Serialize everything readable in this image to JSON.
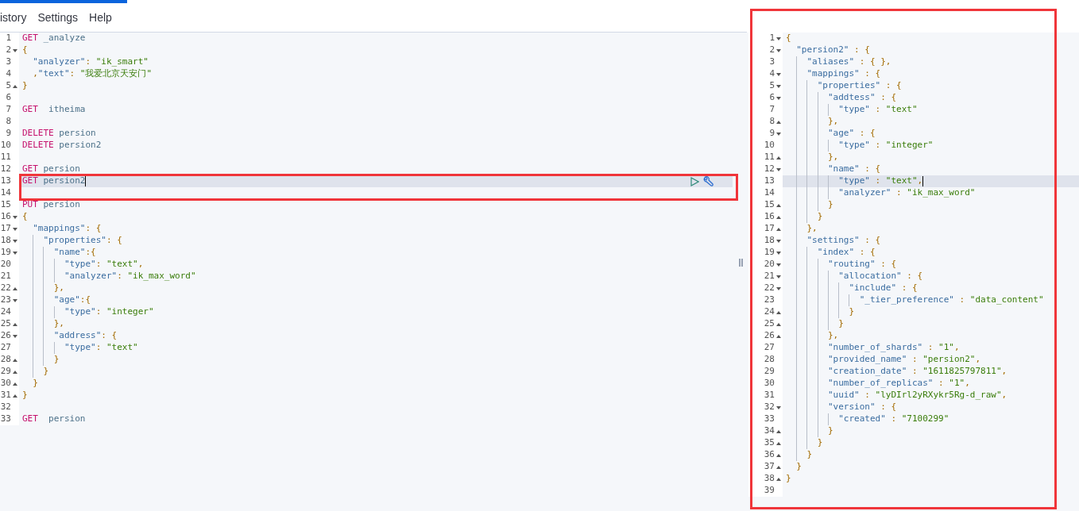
{
  "menu": [
    "istory",
    "Settings",
    "Help"
  ],
  "request_editor": {
    "lines": [
      {
        "n": "1",
        "selected": false,
        "tokens": [
          {
            "kind": "method",
            "t": "GET"
          },
          {
            "kind": "path",
            "t": " _analyze"
          }
        ]
      },
      {
        "n": "2",
        "selected": false,
        "expanded": true,
        "tokens": [
          {
            "kind": "punct",
            "t": "{"
          }
        ]
      },
      {
        "n": "3",
        "selected": false,
        "tokens": [
          {
            "kind": "key",
            "t": "\"analyzer\""
          },
          {
            "kind": "punct",
            "t": ": "
          },
          {
            "kind": "string",
            "t": "\"ik_smart\""
          }
        ]
      },
      {
        "n": "4",
        "selected": false,
        "tokens": [
          {
            "kind": "punct",
            "t": ","
          },
          {
            "kind": "key",
            "t": "\"text\""
          },
          {
            "kind": "punct",
            "t": ": "
          },
          {
            "kind": "string",
            "t": "\"我爱北京天安门\""
          }
        ]
      },
      {
        "n": "5",
        "selected": false,
        "fold_end": true,
        "tokens": [
          {
            "kind": "punct",
            "t": "}"
          }
        ]
      },
      {
        "n": "6",
        "selected": false
      },
      {
        "n": "7",
        "selected": false,
        "tokens": [
          {
            "kind": "method",
            "t": "GET"
          },
          {
            "kind": "path",
            "t": "  itheima"
          }
        ]
      },
      {
        "n": "8",
        "selected": false
      },
      {
        "n": "9",
        "selected": false,
        "tokens": [
          {
            "kind": "method",
            "t": "DELETE"
          },
          {
            "kind": "path",
            "t": " persion"
          }
        ]
      },
      {
        "n": "10",
        "selected": false,
        "tokens": [
          {
            "kind": "method",
            "t": "DELETE"
          },
          {
            "kind": "path",
            "t": " persion2"
          }
        ]
      },
      {
        "n": "11",
        "selected": false
      },
      {
        "n": "12",
        "selected": false,
        "tokens": [
          {
            "kind": "method",
            "t": "GET"
          },
          {
            "kind": "path",
            "t": " persion"
          }
        ]
      },
      {
        "n": "13",
        "selected": true,
        "tokens": [
          {
            "kind": "method",
            "t": "GET"
          },
          {
            "kind": "path",
            "t": " persion2"
          }
        ]
      },
      {
        "n": "14",
        "selected": false
      },
      {
        "n": "15",
        "selected": false,
        "tokens": [
          {
            "kind": "method",
            "t": "PUT"
          },
          {
            "kind": "path",
            "t": " persion"
          }
        ]
      },
      {
        "n": "16",
        "selected": false,
        "expanded": true,
        "tokens": [
          {
            "kind": "punct",
            "t": "{"
          }
        ]
      },
      {
        "n": "17",
        "selected": false,
        "expanded": true,
        "tokens": [
          {
            "kind": "key",
            "t": "\"mappings\""
          },
          {
            "kind": "punct",
            "t": ": {"
          }
        ]
      },
      {
        "n": "18",
        "selected": false,
        "expanded": true,
        "tokens": [
          {
            "kind": "key",
            "t": "\"properties\""
          },
          {
            "kind": "punct",
            "t": ": {"
          }
        ]
      },
      {
        "n": "19",
        "selected": false,
        "expanded": true,
        "tokens": [
          {
            "kind": "key",
            "t": "\"name\""
          },
          {
            "kind": "punct",
            "t": ":{"
          }
        ]
      },
      {
        "n": "20",
        "selected": false,
        "tokens": [
          {
            "kind": "key",
            "t": "\"type\""
          },
          {
            "kind": "punct",
            "t": ": "
          },
          {
            "kind": "string",
            "t": "\"text\""
          },
          {
            "kind": "punct",
            "t": ","
          }
        ]
      },
      {
        "n": "21",
        "selected": false,
        "tokens": [
          {
            "kind": "key",
            "t": "\"analyzer\""
          },
          {
            "kind": "punct",
            "t": ": "
          },
          {
            "kind": "string",
            "t": "\"ik_max_word\""
          }
        ]
      },
      {
        "n": "22",
        "selected": false,
        "fold_end": true,
        "tokens": [
          {
            "kind": "punct",
            "t": "},"
          }
        ]
      },
      {
        "n": "23",
        "selected": false,
        "expanded": true,
        "tokens": [
          {
            "kind": "key",
            "t": "\"age\""
          },
          {
            "kind": "punct",
            "t": ":{"
          }
        ]
      },
      {
        "n": "24",
        "selected": false,
        "tokens": [
          {
            "kind": "key",
            "t": "\"type\""
          },
          {
            "kind": "punct",
            "t": ": "
          },
          {
            "kind": "string",
            "t": "\"integer\""
          }
        ]
      },
      {
        "n": "25",
        "selected": false,
        "fold_end": true,
        "tokens": [
          {
            "kind": "punct",
            "t": "},"
          }
        ]
      },
      {
        "n": "26",
        "selected": false,
        "expanded": true,
        "tokens": [
          {
            "kind": "key",
            "t": "\"address\""
          },
          {
            "kind": "punct",
            "t": ": {"
          }
        ]
      },
      {
        "n": "27",
        "selected": false,
        "tokens": [
          {
            "kind": "key",
            "t": "\"type\""
          },
          {
            "kind": "punct",
            "t": ": "
          },
          {
            "kind": "string",
            "t": "\"text\""
          }
        ]
      },
      {
        "n": "28",
        "selected": false,
        "fold_end": true,
        "tokens": [
          {
            "kind": "punct",
            "t": "}"
          }
        ]
      },
      {
        "n": "29",
        "selected": false,
        "fold_end": true,
        "tokens": [
          {
            "kind": "punct",
            "t": "}"
          }
        ]
      },
      {
        "n": "30",
        "selected": false,
        "fold_end": true,
        "tokens": [
          {
            "kind": "punct",
            "t": "}"
          }
        ]
      },
      {
        "n": "31",
        "selected": false,
        "fold_end": true,
        "tokens": [
          {
            "kind": "punct",
            "t": "}"
          }
        ]
      },
      {
        "n": "32",
        "selected": false
      },
      {
        "n": "33",
        "selected": false,
        "tokens": [
          {
            "kind": "method",
            "t": "GET"
          },
          {
            "kind": "path",
            "t": "  persion"
          }
        ]
      }
    ]
  },
  "response_viewer": {
    "lines": [
      {
        "n": "1",
        "selected": false,
        "expanded": true,
        "tokens": [
          {
            "kind": "punct",
            "t": "{"
          }
        ]
      },
      {
        "n": "2",
        "selected": false,
        "expanded": true,
        "tokens": [
          {
            "kind": "key",
            "t": "\"persion2\""
          },
          {
            "kind": "punct",
            "t": " : {"
          }
        ]
      },
      {
        "n": "3",
        "selected": false,
        "tokens": [
          {
            "kind": "key",
            "t": "\"aliases\""
          },
          {
            "kind": "punct",
            "t": " : { },"
          }
        ]
      },
      {
        "n": "4",
        "selected": false,
        "expanded": true,
        "tokens": [
          {
            "kind": "key",
            "t": "\"mappings\""
          },
          {
            "kind": "punct",
            "t": " : {"
          }
        ]
      },
      {
        "n": "5",
        "selected": false,
        "expanded": true,
        "tokens": [
          {
            "kind": "key",
            "t": "\"properties\""
          },
          {
            "kind": "punct",
            "t": " : {"
          }
        ]
      },
      {
        "n": "6",
        "selected": false,
        "expanded": true,
        "tokens": [
          {
            "kind": "key",
            "t": "\"addtess\""
          },
          {
            "kind": "punct",
            "t": " : {"
          }
        ]
      },
      {
        "n": "7",
        "selected": false,
        "tokens": [
          {
            "kind": "key",
            "t": "\"type\""
          },
          {
            "kind": "punct",
            "t": " : "
          },
          {
            "kind": "string",
            "t": "\"text\""
          }
        ]
      },
      {
        "n": "8",
        "selected": false,
        "fold_end": true,
        "tokens": [
          {
            "kind": "punct",
            "t": "},"
          }
        ]
      },
      {
        "n": "9",
        "selected": false,
        "expanded": true,
        "tokens": [
          {
            "kind": "key",
            "t": "\"age\""
          },
          {
            "kind": "punct",
            "t": " : {"
          }
        ]
      },
      {
        "n": "10",
        "selected": false,
        "tokens": [
          {
            "kind": "key",
            "t": "\"type\""
          },
          {
            "kind": "punct",
            "t": " : "
          },
          {
            "kind": "string",
            "t": "\"integer\""
          }
        ]
      },
      {
        "n": "11",
        "selected": false,
        "fold_end": true,
        "tokens": [
          {
            "kind": "punct",
            "t": "},"
          }
        ]
      },
      {
        "n": "12",
        "selected": false,
        "expanded": true,
        "tokens": [
          {
            "kind": "key",
            "t": "\"name\""
          },
          {
            "kind": "punct",
            "t": " : {"
          }
        ]
      },
      {
        "n": "13",
        "selected": true,
        "tokens": [
          {
            "kind": "key",
            "t": "\"type\""
          },
          {
            "kind": "punct",
            "t": " : "
          },
          {
            "kind": "string",
            "t": "\"text\""
          },
          {
            "kind": "punct",
            "t": ","
          }
        ]
      },
      {
        "n": "14",
        "selected": false,
        "tokens": [
          {
            "kind": "key",
            "t": "\"analyzer\""
          },
          {
            "kind": "punct",
            "t": " : "
          },
          {
            "kind": "string",
            "t": "\"ik_max_word\""
          }
        ]
      },
      {
        "n": "15",
        "selected": false,
        "fold_end": true,
        "tokens": [
          {
            "kind": "punct",
            "t": "}"
          }
        ]
      },
      {
        "n": "16",
        "selected": false,
        "fold_end": true,
        "tokens": [
          {
            "kind": "punct",
            "t": "}"
          }
        ]
      },
      {
        "n": "17",
        "selected": false,
        "fold_end": true,
        "tokens": [
          {
            "kind": "punct",
            "t": "},"
          }
        ]
      },
      {
        "n": "18",
        "selected": false,
        "expanded": true,
        "tokens": [
          {
            "kind": "key",
            "t": "\"settings\""
          },
          {
            "kind": "punct",
            "t": " : {"
          }
        ]
      },
      {
        "n": "19",
        "selected": false,
        "expanded": true,
        "tokens": [
          {
            "kind": "key",
            "t": "\"index\""
          },
          {
            "kind": "punct",
            "t": " : {"
          }
        ]
      },
      {
        "n": "20",
        "selected": false,
        "expanded": true,
        "tokens": [
          {
            "kind": "key",
            "t": "\"routing\""
          },
          {
            "kind": "punct",
            "t": " : {"
          }
        ]
      },
      {
        "n": "21",
        "selected": false,
        "expanded": true,
        "tokens": [
          {
            "kind": "key",
            "t": "\"allocation\""
          },
          {
            "kind": "punct",
            "t": " : {"
          }
        ]
      },
      {
        "n": "22",
        "selected": false,
        "expanded": true,
        "tokens": [
          {
            "kind": "key",
            "t": "\"include\""
          },
          {
            "kind": "punct",
            "t": " : {"
          }
        ]
      },
      {
        "n": "23",
        "selected": false,
        "tokens": [
          {
            "kind": "key",
            "t": "\"_tier_preference\""
          },
          {
            "kind": "punct",
            "t": " : "
          },
          {
            "kind": "string",
            "t": "\"data_content\""
          }
        ]
      },
      {
        "n": "24",
        "selected": false,
        "fold_end": true,
        "tokens": [
          {
            "kind": "punct",
            "t": "}"
          }
        ]
      },
      {
        "n": "25",
        "selected": false,
        "fold_end": true,
        "tokens": [
          {
            "kind": "punct",
            "t": "}"
          }
        ]
      },
      {
        "n": "26",
        "selected": false,
        "fold_end": true,
        "tokens": [
          {
            "kind": "punct",
            "t": "},"
          }
        ]
      },
      {
        "n": "27",
        "selected": false,
        "tokens": [
          {
            "kind": "key",
            "t": "\"number_of_shards\""
          },
          {
            "kind": "punct",
            "t": " : "
          },
          {
            "kind": "string",
            "t": "\"1\""
          },
          {
            "kind": "punct",
            "t": ","
          }
        ]
      },
      {
        "n": "28",
        "selected": false,
        "tokens": [
          {
            "kind": "key",
            "t": "\"provided_name\""
          },
          {
            "kind": "punct",
            "t": " : "
          },
          {
            "kind": "string",
            "t": "\"persion2\""
          },
          {
            "kind": "punct",
            "t": ","
          }
        ]
      },
      {
        "n": "29",
        "selected": false,
        "tokens": [
          {
            "kind": "key",
            "t": "\"creation_date\""
          },
          {
            "kind": "punct",
            "t": " : "
          },
          {
            "kind": "string",
            "t": "\"1611825797811\""
          },
          {
            "kind": "punct",
            "t": ","
          }
        ]
      },
      {
        "n": "30",
        "selected": false,
        "tokens": [
          {
            "kind": "key",
            "t": "\"number_of_replicas\""
          },
          {
            "kind": "punct",
            "t": " : "
          },
          {
            "kind": "string",
            "t": "\"1\""
          },
          {
            "kind": "punct",
            "t": ","
          }
        ]
      },
      {
        "n": "31",
        "selected": false,
        "tokens": [
          {
            "kind": "key",
            "t": "\"uuid\""
          },
          {
            "kind": "punct",
            "t": " : "
          },
          {
            "kind": "string",
            "t": "\"lyDIrl2yRXykr5Rg-d_raw\""
          },
          {
            "kind": "punct",
            "t": ","
          }
        ]
      },
      {
        "n": "32",
        "selected": false,
        "expanded": true,
        "tokens": [
          {
            "kind": "key",
            "t": "\"version\""
          },
          {
            "kind": "punct",
            "t": " : {"
          }
        ]
      },
      {
        "n": "33",
        "selected": false,
        "tokens": [
          {
            "kind": "key",
            "t": "\"created\""
          },
          {
            "kind": "punct",
            "t": " : "
          },
          {
            "kind": "string",
            "t": "\"7100299\""
          }
        ]
      },
      {
        "n": "34",
        "selected": false,
        "fold_end": true,
        "tokens": [
          {
            "kind": "punct",
            "t": "}"
          }
        ]
      },
      {
        "n": "35",
        "selected": false,
        "fold_end": true,
        "tokens": [
          {
            "kind": "punct",
            "t": "}"
          }
        ]
      },
      {
        "n": "36",
        "selected": false,
        "fold_end": true,
        "tokens": [
          {
            "kind": "punct",
            "t": "}"
          }
        ]
      },
      {
        "n": "37",
        "selected": false,
        "fold_end": true,
        "tokens": [
          {
            "kind": "punct",
            "t": "}"
          }
        ]
      },
      {
        "n": "38",
        "selected": false,
        "fold_end": true,
        "tokens": [
          {
            "kind": "punct",
            "t": "}"
          }
        ]
      },
      {
        "n": "39",
        "selected": false
      }
    ]
  }
}
